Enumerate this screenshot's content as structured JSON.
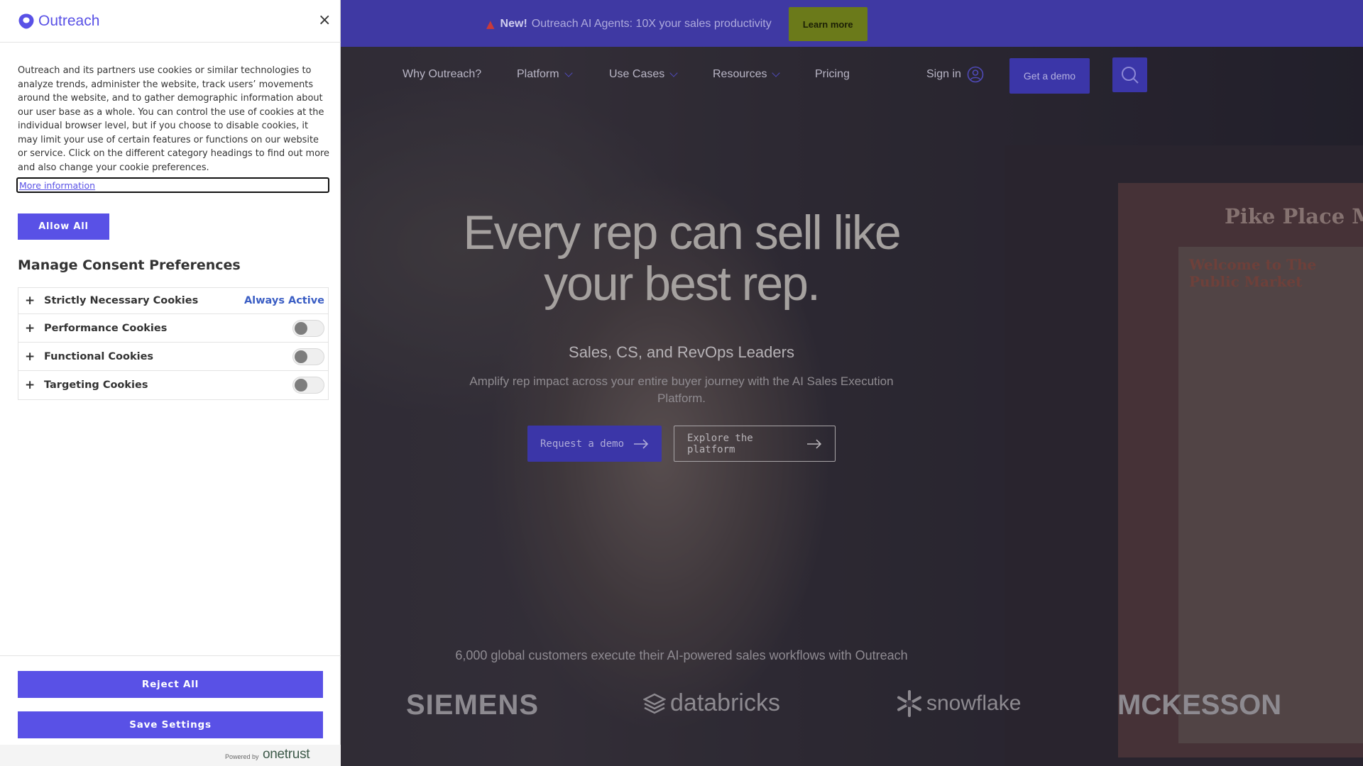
{
  "promo": {
    "new_label": "New!",
    "text": "Outreach AI Agents: 10X your sales productivity",
    "learn_more": "Learn more"
  },
  "nav": {
    "items": [
      "Why Outreach?",
      "Platform",
      "Use Cases",
      "Resources",
      "Pricing"
    ],
    "sign_in": "Sign in",
    "get_demo": "Get a demo"
  },
  "hero": {
    "title_line1": "Every rep can sell like",
    "title_line2": "your best rep.",
    "subtitle": "Sales, CS, and RevOps Leaders",
    "description": "Amplify rep impact across your entire buyer journey with the AI Sales Execution Platform.",
    "request_demo": "Request a demo",
    "explore_platform": "Explore the platform"
  },
  "background_sign": {
    "title": "Pike Place M",
    "welcome": "Welcome to The Public Market"
  },
  "customers": {
    "text": "6,000 global customers execute their AI-powered sales workflows with Outreach",
    "logos": [
      "SIEMENS",
      "databricks",
      "snowflake",
      "MCKESSON"
    ]
  },
  "consent": {
    "brand": "Outreach",
    "close": "×",
    "policy_text": "Outreach and its partners use cookies or similar technologies to analyze trends, administer the website, track users’ movements around the website, and to gather demographic information about our user base as a whole. You can control the use of cookies at the individual browser level, but if you choose to disable cookies, it may limit your use of certain features or functions on our website or service. Click on the different category headings to find out more and also change your cookie preferences.",
    "more_info": "More information",
    "allow_all": "Allow All",
    "manage_title": "Manage Consent Preferences",
    "categories": [
      {
        "label": "Strictly Necessary Cookies",
        "status": "Always Active"
      },
      {
        "label": "Performance Cookies",
        "enabled": false
      },
      {
        "label": "Functional Cookies",
        "enabled": false
      },
      {
        "label": "Targeting Cookies",
        "enabled": false
      }
    ],
    "expand_symbol": "+",
    "reject_all": "Reject All",
    "save_settings": "Save Settings",
    "powered_by": "Powered by",
    "onetrust": "onetrust"
  },
  "colors": {
    "accent": "#5951e6",
    "promo_bg": "#3f39a3",
    "learn_more_bg": "#6b7a1a",
    "always_active": "#3b5ec4"
  }
}
